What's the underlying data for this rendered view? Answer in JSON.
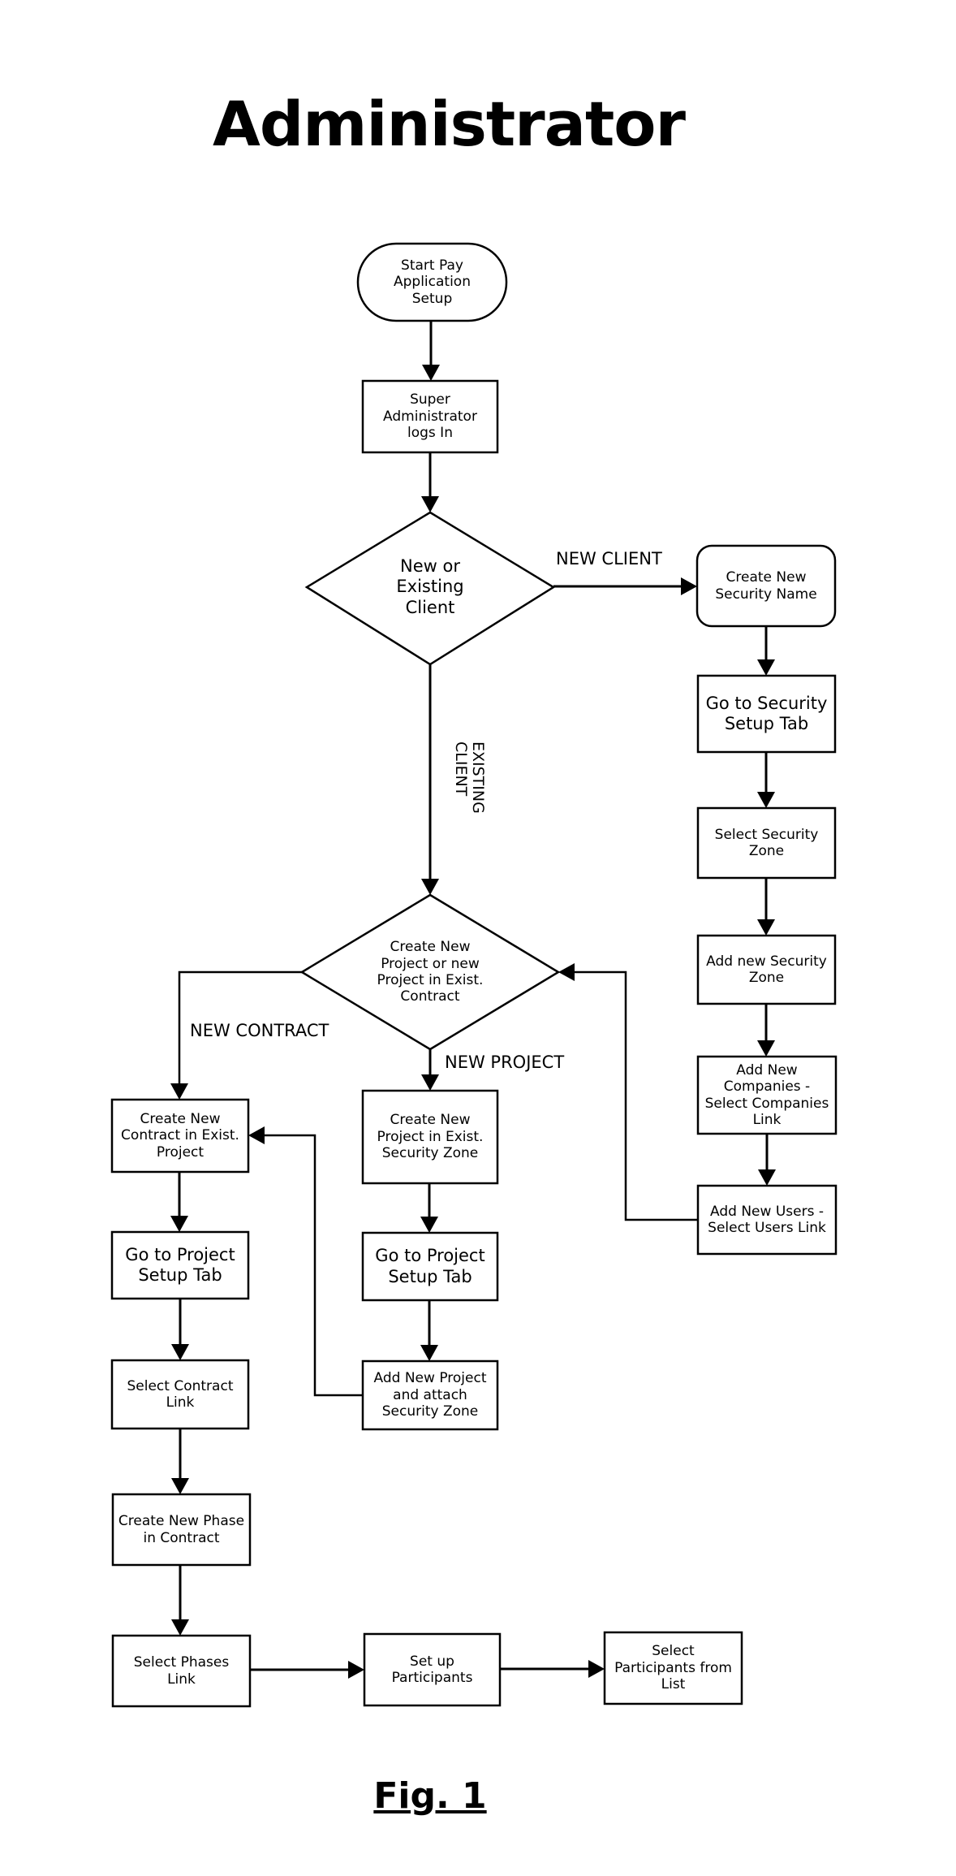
{
  "title": "Administrator",
  "caption": "Fig. 1",
  "nodes": {
    "start": "Start Pay\nApplication\nSetup",
    "super_admin_login": "Super\nAdministrator\nlogs In",
    "decision_client": "New or\nExisting\nClient",
    "create_security_name": "Create New\nSecurity Name",
    "security_setup_tab": "Go to Security\nSetup Tab",
    "select_security_zone": "Select Security\nZone",
    "add_security_zone": "Add new Security\nZone",
    "add_companies": "Add New\nCompanies -\nSelect Companies\nLink",
    "add_users": "Add New Users -\nSelect Users Link",
    "decision_project": "Create New\nProject or new\nProject in Exist.\nContract",
    "create_contract": "Create New\nContract in Exist.\nProject",
    "project_setup_tab_left": "Go to Project\nSetup Tab",
    "select_contract_link": "Select Contract\nLink",
    "create_phase": "Create New Phase\nin Contract",
    "select_phases_link": "Select Phases\nLink",
    "set_up_participants": "Set up\nParticipants",
    "select_participants": "Select\nParticipants from\nList",
    "create_project": "Create New\nProject in Exist.\nSecurity Zone",
    "project_setup_tab_right": "Go to Project\nSetup Tab",
    "add_project_attach_zone": "Add New Project\nand attach\nSecurity Zone"
  },
  "edge_labels": {
    "new_client": "NEW CLIENT",
    "existing_client": "EXISTING\nCLIENT",
    "new_contract": "NEW CONTRACT",
    "new_project": "NEW PROJECT"
  }
}
